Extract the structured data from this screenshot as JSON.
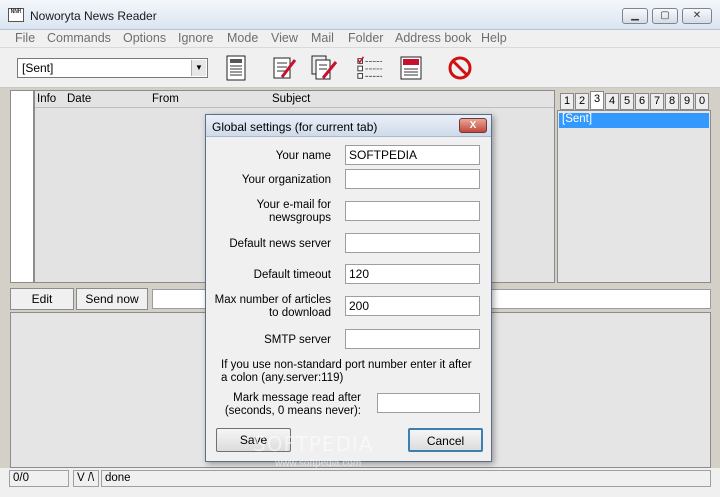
{
  "window": {
    "title": "Noworyta News Reader",
    "app_icon_text": "NNR",
    "minimize": "▁",
    "maximize": "▢",
    "close": "✕"
  },
  "menu": [
    "File",
    "Commands",
    "Options",
    "Ignore",
    "Mode",
    "View",
    "Mail",
    "Folder",
    "Address book",
    "Help"
  ],
  "toolbar": {
    "folder_combo_value": "[Sent]",
    "icons": [
      "newspaper-icon",
      "write-message-icon",
      "reply-message-icon",
      "checklist-icon",
      "spellcheck-icon",
      "stop-icon"
    ]
  },
  "message_list": {
    "columns": [
      "Info",
      "Date",
      "From",
      "Subject"
    ]
  },
  "folder_tabs": {
    "tabs": [
      "1",
      "2",
      "3",
      "4",
      "5",
      "6",
      "7",
      "8",
      "9",
      "0"
    ],
    "active_index": 2,
    "items": [
      "[Sent]"
    ]
  },
  "actions": {
    "edit": "Edit",
    "send_now": "Send now"
  },
  "status": {
    "count": "0/0",
    "mode": "V /\\",
    "message": "done"
  },
  "dialog": {
    "title": "Global settings (for current tab)",
    "close": "X",
    "fields": {
      "name": {
        "label": "Your name",
        "value": "SOFTPEDIA"
      },
      "organization": {
        "label": "Your organization",
        "value": ""
      },
      "email_line1": "Your e-mail for",
      "email_line2": "newsgroups",
      "email_value": "",
      "server": {
        "label": "Default news server",
        "value": ""
      },
      "timeout": {
        "label": "Default timeout",
        "value": "120"
      },
      "max_line1": "Max number of articles",
      "max_line2": "to download",
      "max_value": "200",
      "smtp": {
        "label": "SMTP server",
        "value": ""
      },
      "hint_line1": "If you use non-standard port number enter it after",
      "hint_line2": "a colon (any.server:119)",
      "mark_line1": "Mark message read after",
      "mark_line2": "(seconds, 0 means never):",
      "mark_value": ""
    },
    "save": "Save",
    "cancel": "Cancel"
  },
  "watermark": {
    "main": "SOFTPEDIA",
    "url": "www.softpedia.com"
  }
}
